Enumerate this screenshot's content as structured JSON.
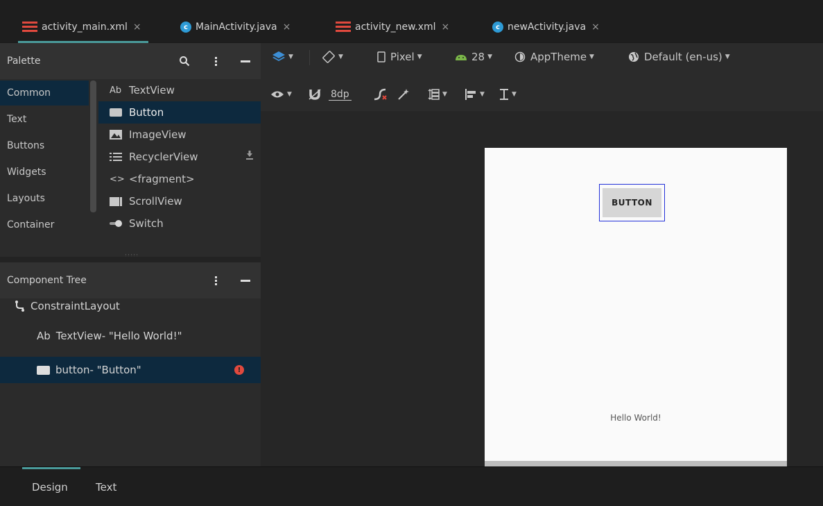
{
  "tabs": [
    {
      "label": "activity_main.xml",
      "type": "xml",
      "active": true
    },
    {
      "label": "MainActivity.java",
      "type": "java",
      "active": false
    },
    {
      "label": "activity_new.xml",
      "type": "xml",
      "active": false
    },
    {
      "label": "newActivity.java",
      "type": "java",
      "active": false
    }
  ],
  "close_glyph": "×",
  "palette": {
    "title": "Palette",
    "categories": [
      "Common",
      "Text",
      "Buttons",
      "Widgets",
      "Layouts",
      "Container"
    ],
    "selected_category": "Common",
    "items": [
      {
        "prefix": "Ab",
        "label": "TextView"
      },
      {
        "prefix": "",
        "label": "Button"
      },
      {
        "prefix": "",
        "label": "ImageView"
      },
      {
        "prefix": "",
        "label": "RecyclerView"
      },
      {
        "prefix": "<>",
        "label": "<fragment>"
      },
      {
        "prefix": "",
        "label": "ScrollView"
      },
      {
        "prefix": "",
        "label": "Switch"
      }
    ],
    "selected_item": "Button"
  },
  "component_tree": {
    "title": "Component Tree",
    "items": [
      {
        "label": "ConstraintLayout"
      },
      {
        "prefix": "Ab",
        "label": "TextView- \"Hello World!\""
      },
      {
        "label": "button- \"Button\""
      }
    ]
  },
  "toolbar": {
    "device": "Pixel",
    "api": "28",
    "theme": "AppTheme",
    "locale": "Default (en-us)",
    "margin": "8dp"
  },
  "preview": {
    "button_text": "BUTTON",
    "text_view": "Hello World!"
  },
  "bottom_tabs": [
    {
      "label": "Design",
      "active": true
    },
    {
      "label": "Text",
      "active": false
    }
  ],
  "colors": {
    "accent": "#4a9b9b",
    "selection": "#0d293e",
    "error": "#e0493e",
    "outline": "#2230d8"
  }
}
